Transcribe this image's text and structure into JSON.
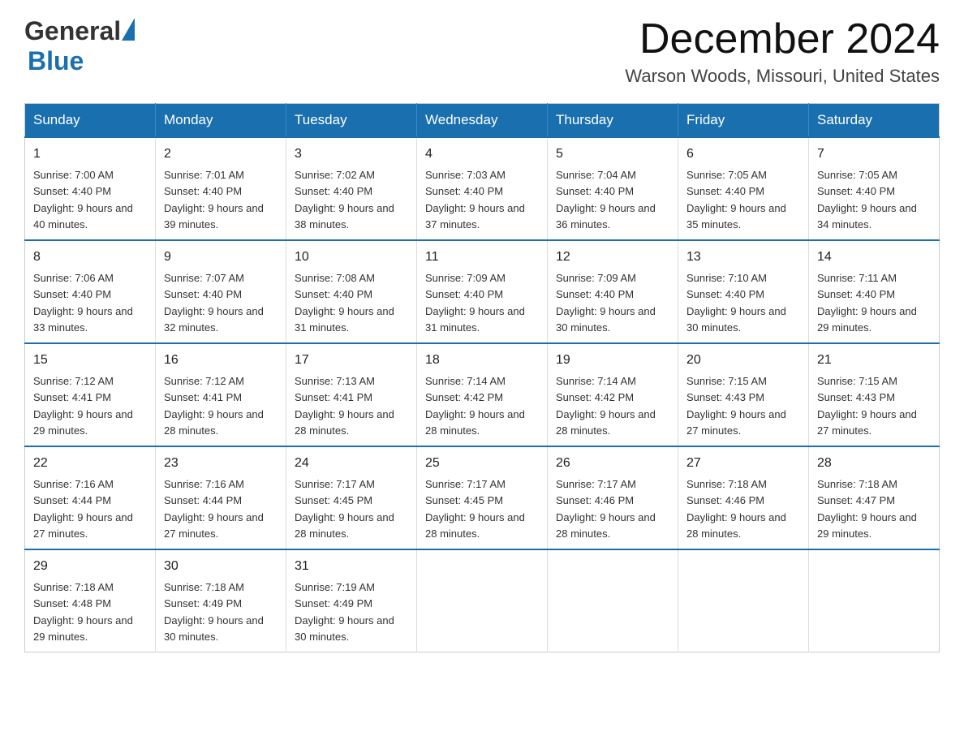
{
  "header": {
    "logo_general": "General",
    "logo_blue": "Blue",
    "month_title": "December 2024",
    "location": "Warson Woods, Missouri, United States"
  },
  "weekdays": [
    "Sunday",
    "Monday",
    "Tuesday",
    "Wednesday",
    "Thursday",
    "Friday",
    "Saturday"
  ],
  "weeks": [
    [
      {
        "day": "1",
        "sunrise": "7:00 AM",
        "sunset": "4:40 PM",
        "daylight": "9 hours and 40 minutes."
      },
      {
        "day": "2",
        "sunrise": "7:01 AM",
        "sunset": "4:40 PM",
        "daylight": "9 hours and 39 minutes."
      },
      {
        "day": "3",
        "sunrise": "7:02 AM",
        "sunset": "4:40 PM",
        "daylight": "9 hours and 38 minutes."
      },
      {
        "day": "4",
        "sunrise": "7:03 AM",
        "sunset": "4:40 PM",
        "daylight": "9 hours and 37 minutes."
      },
      {
        "day": "5",
        "sunrise": "7:04 AM",
        "sunset": "4:40 PM",
        "daylight": "9 hours and 36 minutes."
      },
      {
        "day": "6",
        "sunrise": "7:05 AM",
        "sunset": "4:40 PM",
        "daylight": "9 hours and 35 minutes."
      },
      {
        "day": "7",
        "sunrise": "7:05 AM",
        "sunset": "4:40 PM",
        "daylight": "9 hours and 34 minutes."
      }
    ],
    [
      {
        "day": "8",
        "sunrise": "7:06 AM",
        "sunset": "4:40 PM",
        "daylight": "9 hours and 33 minutes."
      },
      {
        "day": "9",
        "sunrise": "7:07 AM",
        "sunset": "4:40 PM",
        "daylight": "9 hours and 32 minutes."
      },
      {
        "day": "10",
        "sunrise": "7:08 AM",
        "sunset": "4:40 PM",
        "daylight": "9 hours and 31 minutes."
      },
      {
        "day": "11",
        "sunrise": "7:09 AM",
        "sunset": "4:40 PM",
        "daylight": "9 hours and 31 minutes."
      },
      {
        "day": "12",
        "sunrise": "7:09 AM",
        "sunset": "4:40 PM",
        "daylight": "9 hours and 30 minutes."
      },
      {
        "day": "13",
        "sunrise": "7:10 AM",
        "sunset": "4:40 PM",
        "daylight": "9 hours and 30 minutes."
      },
      {
        "day": "14",
        "sunrise": "7:11 AM",
        "sunset": "4:40 PM",
        "daylight": "9 hours and 29 minutes."
      }
    ],
    [
      {
        "day": "15",
        "sunrise": "7:12 AM",
        "sunset": "4:41 PM",
        "daylight": "9 hours and 29 minutes."
      },
      {
        "day": "16",
        "sunrise": "7:12 AM",
        "sunset": "4:41 PM",
        "daylight": "9 hours and 28 minutes."
      },
      {
        "day": "17",
        "sunrise": "7:13 AM",
        "sunset": "4:41 PM",
        "daylight": "9 hours and 28 minutes."
      },
      {
        "day": "18",
        "sunrise": "7:14 AM",
        "sunset": "4:42 PM",
        "daylight": "9 hours and 28 minutes."
      },
      {
        "day": "19",
        "sunrise": "7:14 AM",
        "sunset": "4:42 PM",
        "daylight": "9 hours and 28 minutes."
      },
      {
        "day": "20",
        "sunrise": "7:15 AM",
        "sunset": "4:43 PM",
        "daylight": "9 hours and 27 minutes."
      },
      {
        "day": "21",
        "sunrise": "7:15 AM",
        "sunset": "4:43 PM",
        "daylight": "9 hours and 27 minutes."
      }
    ],
    [
      {
        "day": "22",
        "sunrise": "7:16 AM",
        "sunset": "4:44 PM",
        "daylight": "9 hours and 27 minutes."
      },
      {
        "day": "23",
        "sunrise": "7:16 AM",
        "sunset": "4:44 PM",
        "daylight": "9 hours and 27 minutes."
      },
      {
        "day": "24",
        "sunrise": "7:17 AM",
        "sunset": "4:45 PM",
        "daylight": "9 hours and 28 minutes."
      },
      {
        "day": "25",
        "sunrise": "7:17 AM",
        "sunset": "4:45 PM",
        "daylight": "9 hours and 28 minutes."
      },
      {
        "day": "26",
        "sunrise": "7:17 AM",
        "sunset": "4:46 PM",
        "daylight": "9 hours and 28 minutes."
      },
      {
        "day": "27",
        "sunrise": "7:18 AM",
        "sunset": "4:46 PM",
        "daylight": "9 hours and 28 minutes."
      },
      {
        "day": "28",
        "sunrise": "7:18 AM",
        "sunset": "4:47 PM",
        "daylight": "9 hours and 29 minutes."
      }
    ],
    [
      {
        "day": "29",
        "sunrise": "7:18 AM",
        "sunset": "4:48 PM",
        "daylight": "9 hours and 29 minutes."
      },
      {
        "day": "30",
        "sunrise": "7:18 AM",
        "sunset": "4:49 PM",
        "daylight": "9 hours and 30 minutes."
      },
      {
        "day": "31",
        "sunrise": "7:19 AM",
        "sunset": "4:49 PM",
        "daylight": "9 hours and 30 minutes."
      },
      null,
      null,
      null,
      null
    ]
  ]
}
